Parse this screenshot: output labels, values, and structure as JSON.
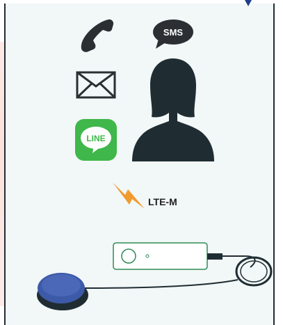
{
  "icons": {
    "phone": "phone-icon",
    "sms": "sms-bubble-icon",
    "mail": "envelope-icon",
    "line": "line-app-icon",
    "person": "person-silhouette-icon",
    "lightning": "lightning-icon",
    "device": "lte-device-icon",
    "button": "push-button-icon"
  },
  "labels": {
    "sms": "SMS",
    "line": "LINE",
    "network": "LTE-M"
  },
  "colors": {
    "dark": "#1f2d33",
    "line_green": "#3fb74a",
    "lightning_orange": "#f29a2e",
    "device_green": "#2e8b57",
    "button_blue": "#3d5aa8",
    "panel_bg": "#f2f7f7"
  }
}
